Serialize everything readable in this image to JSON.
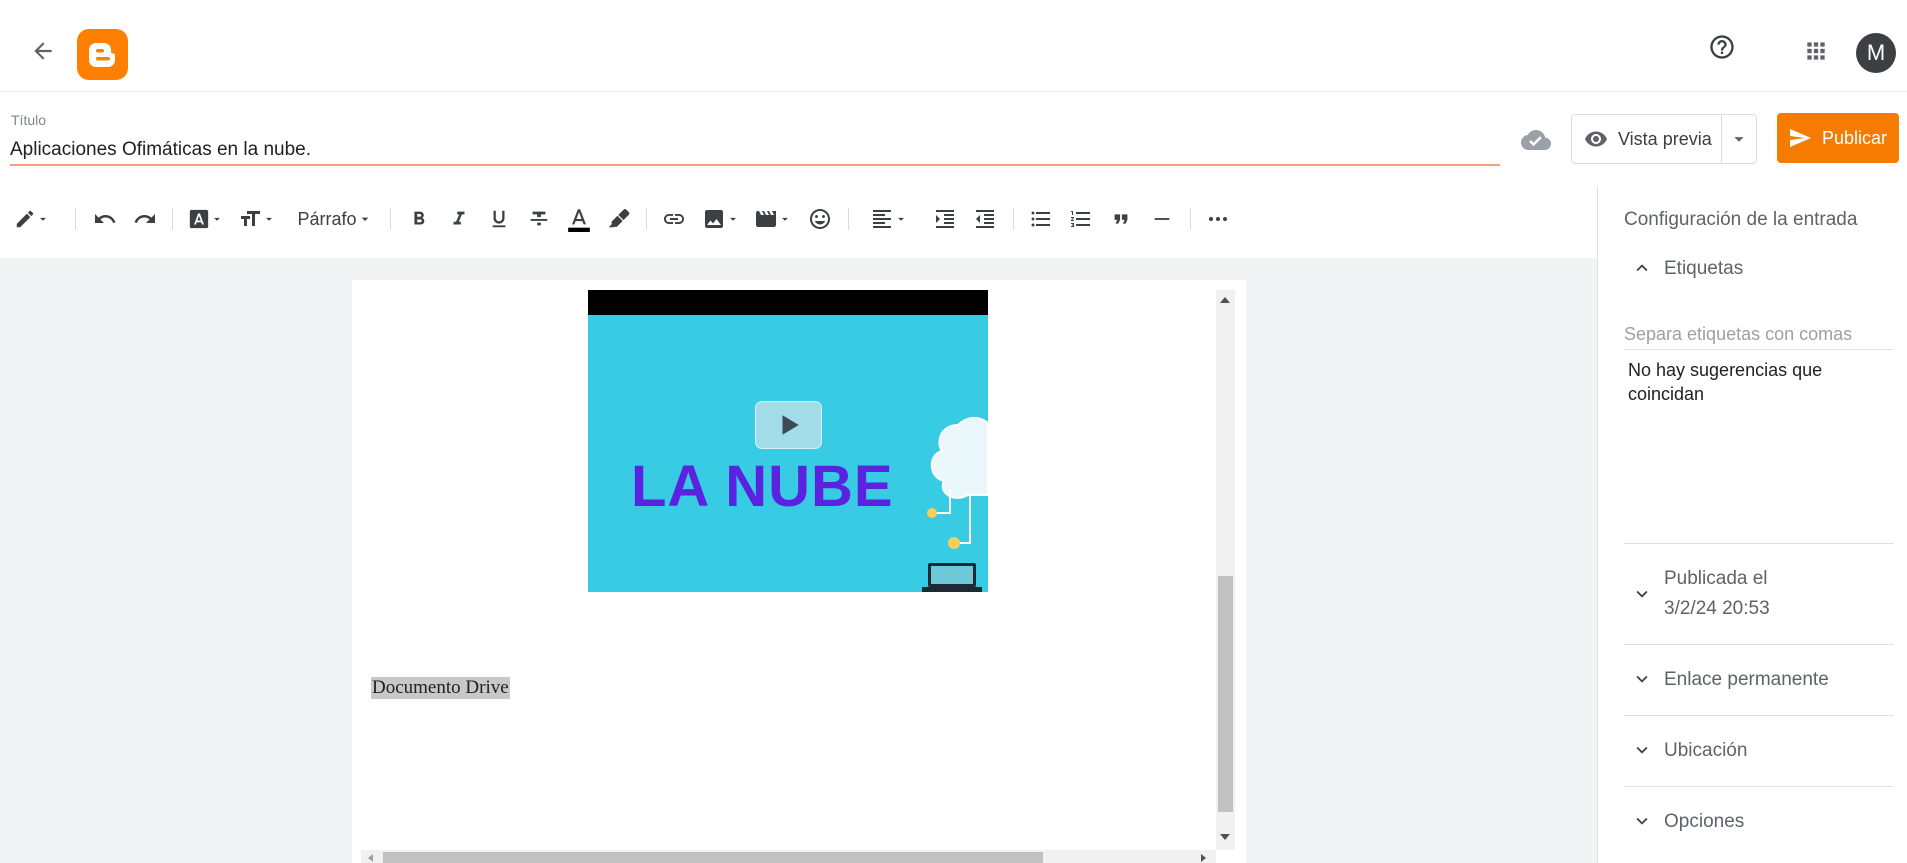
{
  "header": {
    "help_icon": "help-circle-icon",
    "apps_icon": "apps-grid-icon",
    "avatar_letter": "M"
  },
  "title": {
    "label": "Título",
    "value": "Aplicaciones Ofimáticas en la nube."
  },
  "actions": {
    "preview_label": "Vista previa",
    "publish_label": "Publicar"
  },
  "toolbar": {
    "paragraph_label": "Párrafo"
  },
  "editor": {
    "video_title": "LA NUBE",
    "selected_text": "Documento Drive"
  },
  "sidebar": {
    "heading": "Configuración de la entrada",
    "labels": {
      "title": "Etiquetas",
      "placeholder": "Separa etiquetas con comas",
      "no_suggestions": "No hay sugerencias que coincidan"
    },
    "published": {
      "label": "Publicada el",
      "date": "3/2/24 20:53"
    },
    "permalink": "Enlace permanente",
    "location": "Ubicación",
    "options": "Opciones"
  },
  "colors": {
    "brand": "#ff8000",
    "publish": "#f57c00",
    "title_underline": "#f79f79",
    "video_bg": "#37cbe4",
    "video_text": "#5b22df"
  }
}
